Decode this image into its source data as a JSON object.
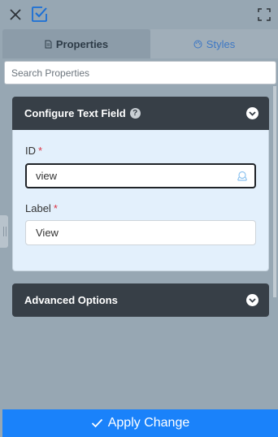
{
  "toolbar": {
    "close_icon": "close-icon",
    "check_icon": "checkbox-icon",
    "expand_icon": "fullscreen-icon"
  },
  "tabs": {
    "properties_label": "Properties",
    "styles_label": "Styles",
    "properties_icon": "document-icon",
    "styles_icon": "palette-icon",
    "active": "Properties"
  },
  "search": {
    "placeholder": "Search Properties",
    "value": ""
  },
  "config_card": {
    "title": "Configure Text Field",
    "help_icon": "question-circle-icon",
    "collapse_icon": "chevron-down-circle-icon",
    "fields": {
      "id_label": "ID",
      "id_value": "view",
      "label_label": "Label",
      "label_value": "View",
      "required_mark": "*"
    }
  },
  "advanced_card": {
    "title": "Advanced Options",
    "expand_icon": "chevron-down-circle-icon"
  },
  "footer": {
    "apply_label": "Apply Change",
    "apply_icon": "check-icon"
  },
  "colors": {
    "panel_bg": "#97a7b3",
    "card_header": "#373f47",
    "card_body": "#e3f0fc",
    "accent": "#1a82fa",
    "styles_tab_text": "#3e78c4",
    "required": "#dc3545"
  }
}
